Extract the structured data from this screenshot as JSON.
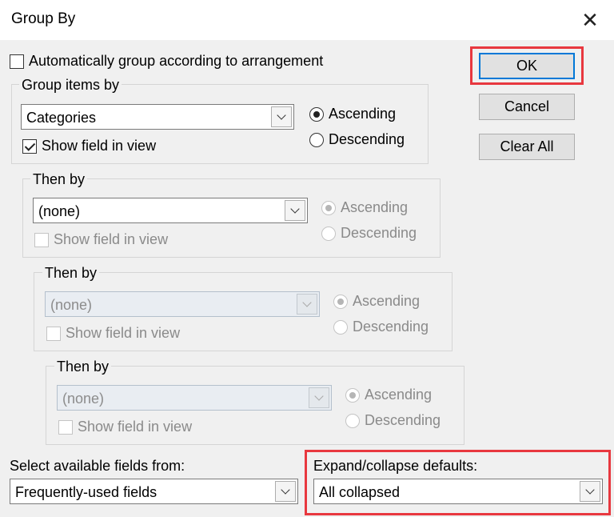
{
  "dialog": {
    "title": "Group By"
  },
  "auto_group": {
    "label": "Automatically group according to arrangement",
    "checked": false
  },
  "groups": [
    {
      "heading": "Group items by",
      "field": "Categories",
      "show_field": "Show field in view",
      "show_checked": true,
      "ascending": "Ascending",
      "descending": "Descending",
      "order": "ascending",
      "enabled": true
    },
    {
      "heading": "Then by",
      "field": "(none)",
      "show_field": "Show field in view",
      "show_checked": false,
      "ascending": "Ascending",
      "descending": "Descending",
      "order": "ascending",
      "enabled": false
    },
    {
      "heading": "Then by",
      "field": "(none)",
      "show_field": "Show field in view",
      "show_checked": false,
      "ascending": "Ascending",
      "descending": "Descending",
      "order": "ascending",
      "enabled": false
    },
    {
      "heading": "Then by",
      "field": "(none)",
      "show_field": "Show field in view",
      "show_checked": false,
      "ascending": "Ascending",
      "descending": "Descending",
      "order": "ascending",
      "enabled": false
    }
  ],
  "buttons": {
    "ok": "OK",
    "cancel": "Cancel",
    "clear_all": "Clear All"
  },
  "fields_from": {
    "label": "Select available fields from:",
    "value": "Frequently-used fields"
  },
  "expand_collapse": {
    "label": "Expand/collapse defaults:",
    "value": "All collapsed"
  },
  "colors": {
    "highlight": "#e8383f",
    "focus": "#0078d7"
  }
}
